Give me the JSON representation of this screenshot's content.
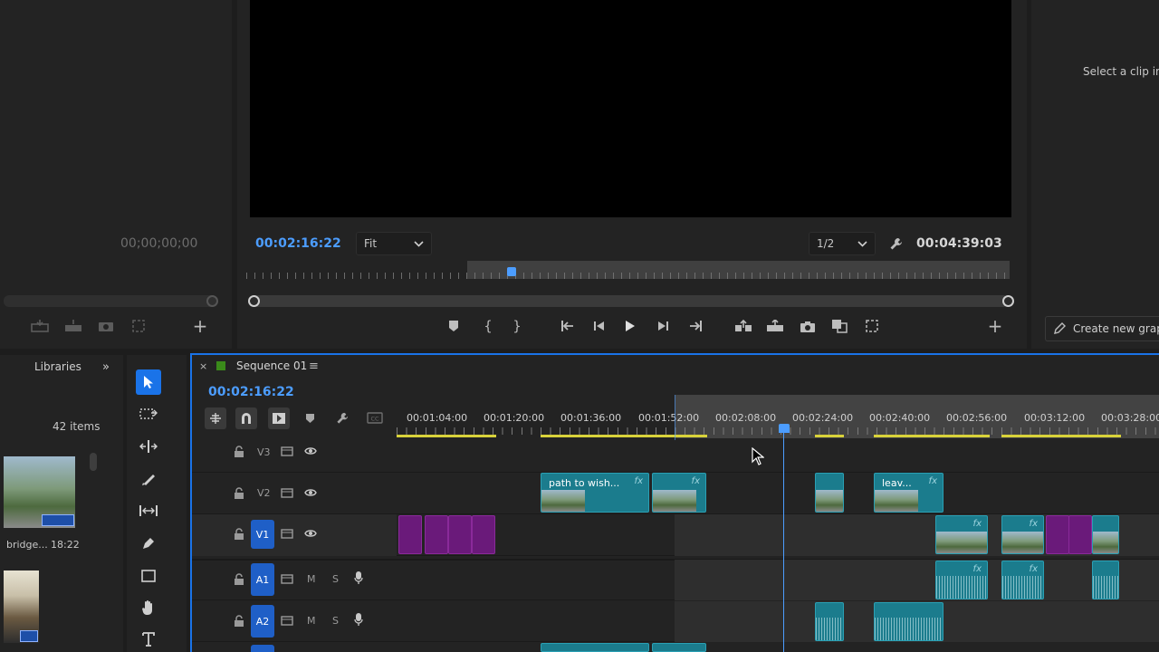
{
  "source_monitor": {
    "timecode": "00;00;00;00"
  },
  "program_monitor": {
    "current_timecode": "00:02:16:22",
    "zoom_value": "Fit",
    "resolution_value": "1/2",
    "duration_timecode": "00:04:39:03",
    "playhead_position": 0.345
  },
  "right_panel": {
    "select_clip_text": "Select a clip in",
    "create_graphic_label": "Create new grapl"
  },
  "project_panel": {
    "libraries_tab": "Libraries",
    "items_count": "42 items",
    "clip1_name": "bridge...",
    "clip1_duration": "18:22"
  },
  "timeline": {
    "sequence_name": "Sequence 01",
    "current_timecode": "00:02:16:22",
    "ruler_ticks": [
      "00:01:04:00",
      "00:01:20:00",
      "00:01:36:00",
      "00:01:52:00",
      "00:02:08:00",
      "00:02:24:00",
      "00:02:40:00",
      "00:02:56:00",
      "00:03:12:00",
      "00:03:28:00"
    ],
    "tracks": [
      {
        "name": "V3"
      },
      {
        "name": "V2"
      },
      {
        "name": "V1"
      },
      {
        "name": "A1",
        "m": "M",
        "s": "S"
      },
      {
        "name": "A2",
        "m": "M",
        "s": "S"
      }
    ],
    "clips": {
      "v2_clip1_label": "path to wish...",
      "v2_clip3_label": "leav...",
      "fx_label": "fx"
    }
  },
  "icons": [
    "close-icon",
    "menu-icon",
    "snap-icon",
    "linked-selection-icon",
    "marker-icon",
    "wrench-icon",
    "captions-icon",
    "lock-icon",
    "film-icon",
    "eye-icon",
    "mic-icon",
    "selection-tool-icon",
    "track-select-icon",
    "ripple-edit-icon",
    "razor-icon",
    "slip-icon",
    "pen-icon",
    "rectangle-icon",
    "hand-icon",
    "type-icon",
    "play-icon",
    "step-back-icon",
    "step-forward-icon",
    "go-to-in-icon",
    "go-to-out-icon",
    "mark-in-icon",
    "mark-out-icon",
    "lift-icon",
    "extract-icon",
    "camera-icon",
    "compare-icon",
    "plus-icon"
  ],
  "colors": {
    "accent_blue": "#4c9dff",
    "clip_teal": "#1b7c8d",
    "clip_purple": "#6a1a7a",
    "track_highlight": "#1f5fc7",
    "ruler_yellow": "#d8d23a",
    "sequence_swatch": "#3a8a1a"
  }
}
